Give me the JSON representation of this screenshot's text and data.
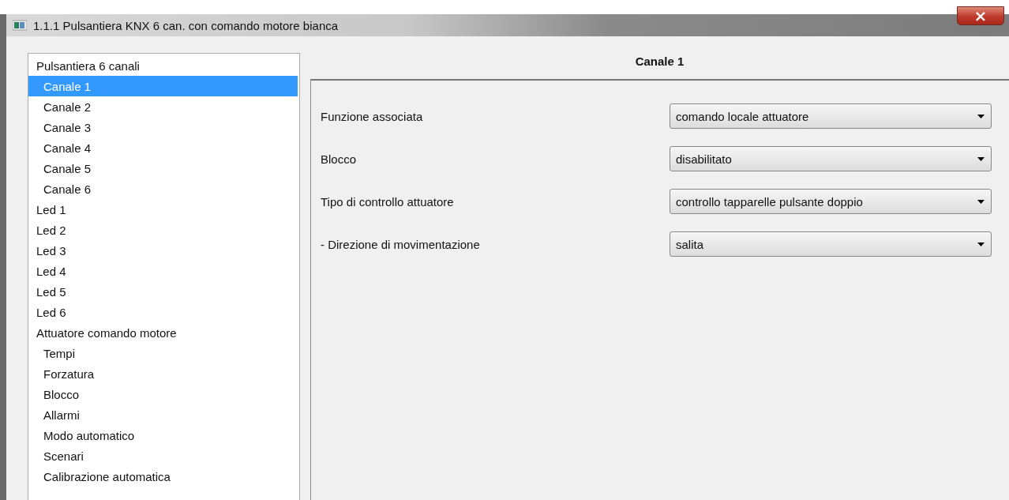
{
  "window": {
    "title": "1.1.1 Pulsantiera KNX 6 can. con comando motore bianca",
    "close": "×"
  },
  "tree": [
    {
      "label": "Pulsantiera 6 canali",
      "selected": false,
      "children": [
        {
          "label": "Canale 1",
          "selected": true
        },
        {
          "label": "Canale 2",
          "selected": false
        },
        {
          "label": "Canale 3",
          "selected": false
        },
        {
          "label": "Canale 4",
          "selected": false
        },
        {
          "label": "Canale 5",
          "selected": false
        },
        {
          "label": "Canale 6",
          "selected": false
        }
      ]
    },
    {
      "label": "Led 1",
      "selected": false
    },
    {
      "label": "Led 2",
      "selected": false
    },
    {
      "label": "Led 3",
      "selected": false
    },
    {
      "label": "Led 4",
      "selected": false
    },
    {
      "label": "Led 5",
      "selected": false
    },
    {
      "label": "Led 6",
      "selected": false
    },
    {
      "label": "Attuatore comando motore",
      "selected": false,
      "children": [
        {
          "label": "Tempi",
          "selected": false
        },
        {
          "label": "Forzatura",
          "selected": false
        },
        {
          "label": "Blocco",
          "selected": false
        },
        {
          "label": "Allarmi",
          "selected": false
        },
        {
          "label": "Modo automatico",
          "selected": false
        },
        {
          "label": "Scenari",
          "selected": false
        },
        {
          "label": "Calibrazione automatica",
          "selected": false
        }
      ]
    }
  ],
  "panel": {
    "heading": "Canale 1",
    "parameters": [
      {
        "label": "Funzione associata",
        "value": "comando locale attuatore"
      },
      {
        "label": "Blocco",
        "value": "disabilitato"
      },
      {
        "label": "Tipo di controllo attuatore",
        "value": "controllo tapparelle pulsante doppio"
      },
      {
        "label": "- Direzione di movimentazione",
        "value": "salita"
      }
    ]
  }
}
